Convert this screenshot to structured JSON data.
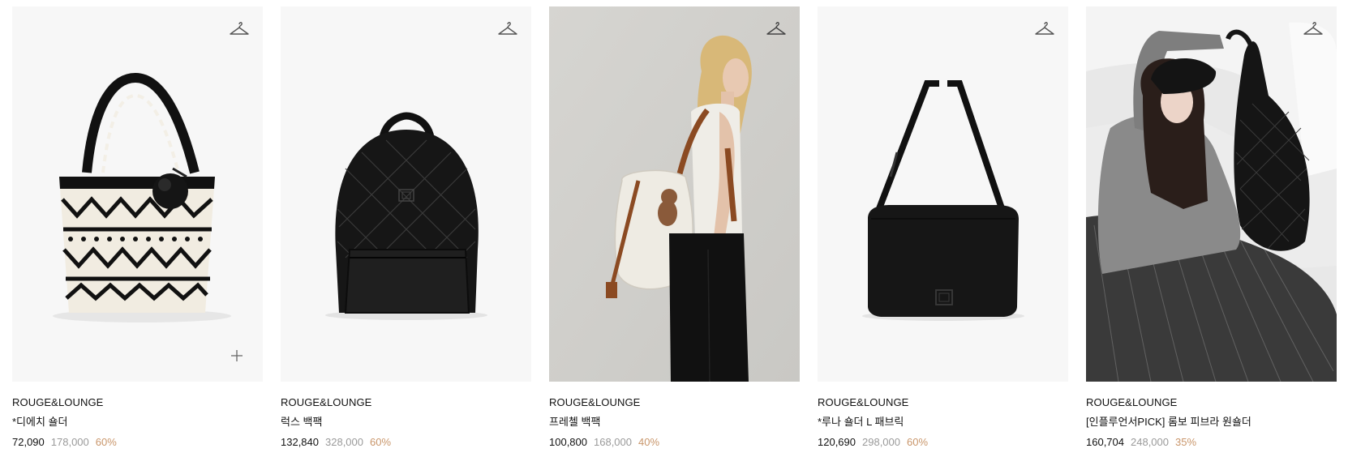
{
  "products": [
    {
      "brand": "ROUGE&LOUNGE",
      "name": "*디에치 숄더",
      "sale_price": "72,090",
      "original_price": "178,000",
      "discount": "60%",
      "image_subject": "black-and-white-patterned-tote-with-pompom",
      "background": "#f7f7f7"
    },
    {
      "brand": "ROUGE&LOUNGE",
      "name": "럭스 백팩",
      "sale_price": "132,840",
      "original_price": "328,000",
      "discount": "60%",
      "image_subject": "black-quilted-backpack",
      "background": "#f7f7f7"
    },
    {
      "brand": "ROUGE&LOUNGE",
      "name": "프레첼 백팩",
      "sale_price": "100,800",
      "original_price": "168,000",
      "discount": "40%",
      "image_subject": "model-wearing-cream-backpack",
      "background": "#d9d8d4"
    },
    {
      "brand": "ROUGE&LOUNGE",
      "name": "*루나 숄더 L 패브릭",
      "sale_price": "120,690",
      "original_price": "298,000",
      "discount": "60%",
      "image_subject": "black-fabric-shoulder-bag",
      "background": "#f7f7f7"
    },
    {
      "brand": "ROUGE&LOUNGE",
      "name": "[인플루언서PICK] 롬보 피브라 원숄더",
      "sale_price": "160,704",
      "original_price": "248,000",
      "discount": "35%",
      "image_subject": "model-holding-black-quilted-hobo",
      "background": "#e9e9e9"
    }
  ],
  "icons": {
    "wishlist": "hanger-icon",
    "quick_add": "plus-icon"
  },
  "colors": {
    "sale_price": "#111111",
    "original_price": "#9a9a9a",
    "discount": "#c9966b"
  }
}
